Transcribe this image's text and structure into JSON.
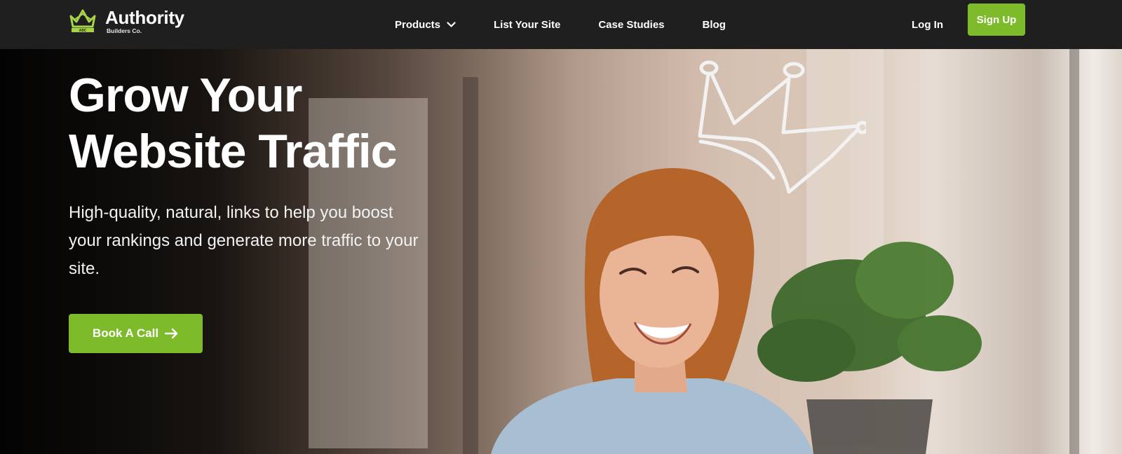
{
  "brand": {
    "name": "Authority",
    "sub": "Builders Co.",
    "mark_text": "ABC",
    "accent": "#7dbb2b"
  },
  "nav": {
    "items": [
      {
        "label": "Products",
        "has_dropdown": true
      },
      {
        "label": "List Your Site"
      },
      {
        "label": "Case Studies"
      },
      {
        "label": "Blog"
      }
    ],
    "login": "Log In",
    "signup": "Sign Up"
  },
  "hero": {
    "headline_line1": "Grow Your",
    "headline_line2": "Website Traffic",
    "subtext": "High-quality, natural, links to help you boost your rankings and generate more traffic to your site.",
    "cta": "Book A Call",
    "cta_icon": "arrow-right-icon",
    "decoration": "crown-doodle-icon"
  },
  "colors": {
    "nav_bg": "#1f1f1f",
    "button_green": "#7dbb2b",
    "text": "#ffffff"
  }
}
